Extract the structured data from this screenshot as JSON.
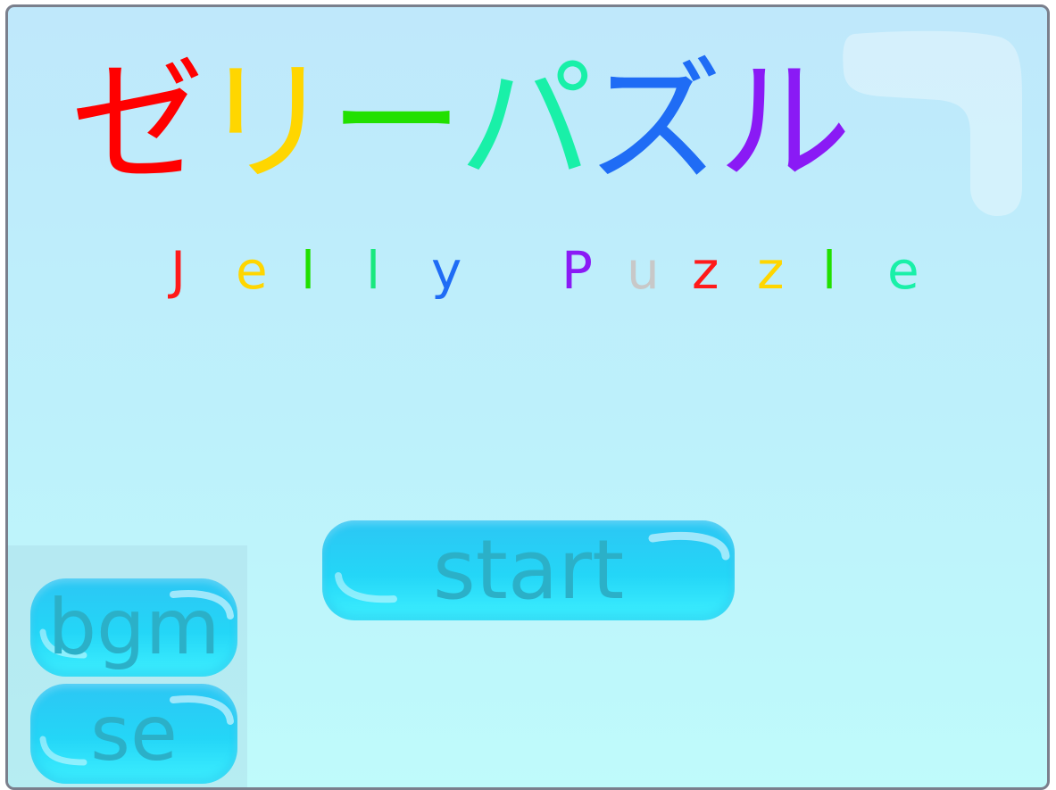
{
  "title": {
    "japanese": [
      {
        "char": "ゼ",
        "color": "#ff0000"
      },
      {
        "char": "リ",
        "color": "#ffd600"
      },
      {
        "char": "ー",
        "color": "#22e000"
      },
      {
        "char": "パ",
        "color": "#19f0a8"
      },
      {
        "char": "ズ",
        "color": "#1f6cf5"
      },
      {
        "char": "ル",
        "color": "#8a1af5"
      }
    ],
    "english": [
      {
        "char": "J",
        "color": "#ff1a1a"
      },
      {
        "char": "e",
        "color": "#ffd600"
      },
      {
        "char": "l",
        "color": "#22e000"
      },
      {
        "char": "l",
        "color": "#19e87e"
      },
      {
        "char": "y",
        "color": "#1f6cf5"
      },
      {
        "char": " ",
        "color": "#000000"
      },
      {
        "char": "P",
        "color": "#8a1af5"
      },
      {
        "char": "u",
        "color": "#c8c8c8"
      },
      {
        "char": "z",
        "color": "#ff1a1a"
      },
      {
        "char": "z",
        "color": "#ffd600"
      },
      {
        "char": "l",
        "color": "#22e000"
      },
      {
        "char": "e",
        "color": "#19f0a8"
      }
    ]
  },
  "buttons": {
    "start_label": "start",
    "bgm_label": "bgm",
    "se_label": "se"
  },
  "colors": {
    "background_top": "#bfe8fb",
    "background_bottom": "#bffbfb",
    "button_text": "#2bb0c8",
    "button_fill": "#2cc6f4"
  }
}
